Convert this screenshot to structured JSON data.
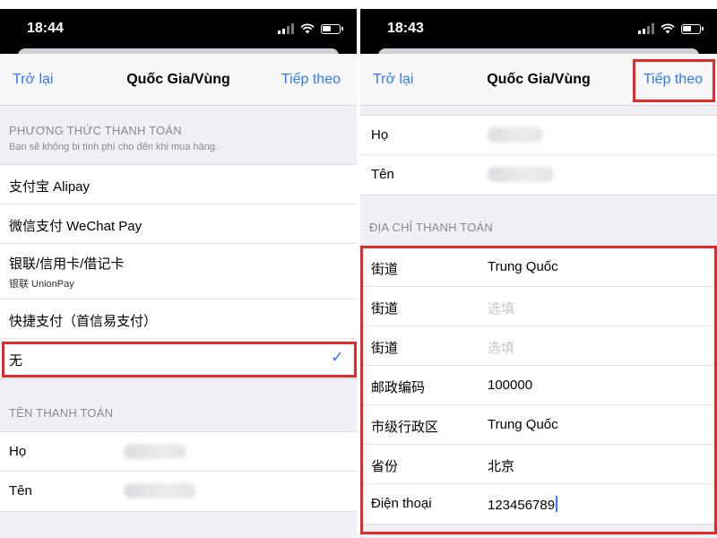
{
  "left": {
    "status_time": "18:44",
    "nav": {
      "back": "Trở lại",
      "title": "Quốc Gia/Vùng",
      "next": "Tiếp theo"
    },
    "payment": {
      "header": "PHƯƠNG THỨC THANH TOÁN",
      "subheader": "Bạn sẽ không bị tính phí cho đến khi mua hàng.",
      "options": [
        {
          "label": "支付宝 Alipay"
        },
        {
          "label": "微信支付 WeChat Pay"
        },
        {
          "label": "银联/信用卡/借记卡",
          "sublabel": "银联 UnionPay"
        },
        {
          "label": "快捷支付（首信易支付）"
        },
        {
          "label": "无",
          "selected": true
        }
      ]
    },
    "billing_name": {
      "header": "TÊN THANH TOÁN",
      "fields": [
        {
          "label": "Họ"
        },
        {
          "label": "Tên"
        }
      ]
    }
  },
  "right": {
    "status_time": "18:43",
    "nav": {
      "back": "Trở lại",
      "title": "Quốc Gia/Vùng",
      "next": "Tiếp theo"
    },
    "name_fields": [
      {
        "label": "Họ"
      },
      {
        "label": "Tên"
      }
    ],
    "billing_address": {
      "header": "ĐỊA CHỈ THANH TOÁN",
      "fields": [
        {
          "label": "街道",
          "value": "Trung Quốc"
        },
        {
          "label": "街道",
          "placeholder": "选填"
        },
        {
          "label": "街道",
          "placeholder": "选填"
        },
        {
          "label": "邮政编码",
          "value": "100000"
        },
        {
          "label": "市级行政区",
          "value": "Trung Quốc"
        },
        {
          "label": "省份",
          "value": "北京"
        },
        {
          "label": "Điện thoại",
          "value": "123456789"
        }
      ]
    }
  },
  "colors": {
    "accent": "#2f7bf6",
    "highlight": "#e32a2a",
    "background": "#efeff4"
  },
  "icons": [
    "signal-icon",
    "wifi-icon",
    "battery-icon",
    "checkmark-icon"
  ]
}
